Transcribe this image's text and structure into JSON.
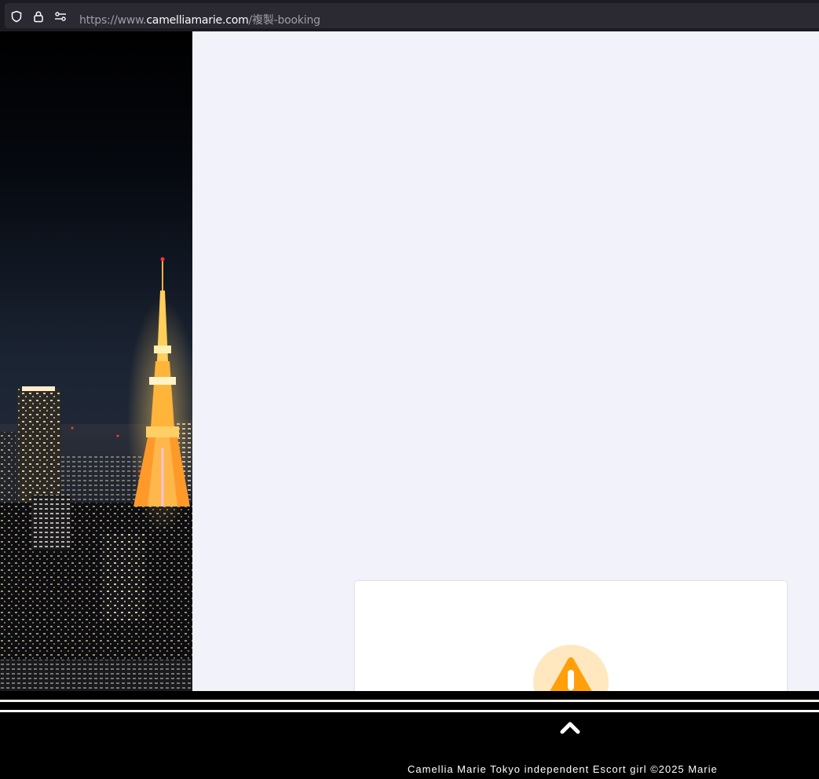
{
  "browser": {
    "url_prefix": "https://www.",
    "url_host": "camelliamarie.com",
    "url_path": "/複製-booking",
    "icons": [
      "shield-icon",
      "lock-icon",
      "permissions-icon"
    ]
  },
  "main": {
    "hero_image": "tokyo-tower-night-skyline",
    "card": {
      "icon": "warning-icon"
    }
  },
  "footer": {
    "back_to_top_icon": "chevron-up-icon",
    "copyright": "Camellia Marie Tokyo independent Escort girl ©2025 Marie"
  },
  "colors": {
    "page_background": "#f2f2fb",
    "warning_accent": "#ff9f0a",
    "warning_soft": "#ffe8c0",
    "footer": "#000000"
  }
}
